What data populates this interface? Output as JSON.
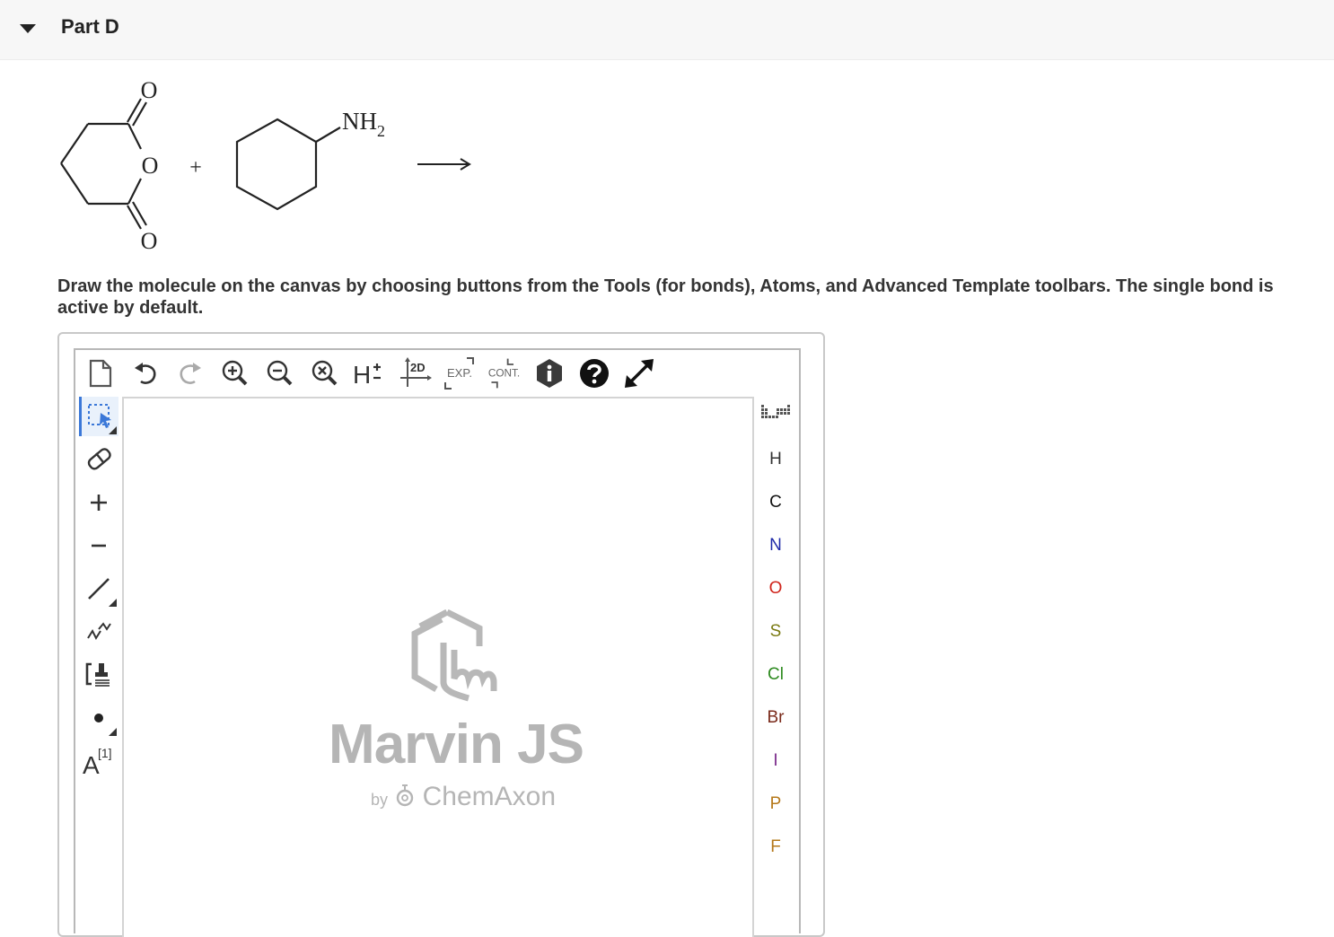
{
  "part": {
    "title": "Part D"
  },
  "reaction": {
    "reactant1_atoms": [
      "O",
      "O",
      "O"
    ],
    "plus": "+",
    "reactant2_group_main": "NH",
    "reactant2_group_sub": "2"
  },
  "instructions": "Draw the molecule on the canvas by choosing buttons from the Tools (for bonds), Atoms, and Advanced Template toolbars. The single bond is active by default.",
  "toolbar": {
    "h_label": "H",
    "clean2d_label": "2D",
    "expand_label": "EXP.",
    "contract_label": "CONT."
  },
  "left_tools": {
    "map_label": "A",
    "map_sup": "[1]"
  },
  "watermark": {
    "title": "Marvin JS",
    "by": "by",
    "brand": "ChemAxon"
  },
  "atoms": [
    {
      "symbol": "H",
      "color": "#333333"
    },
    {
      "symbol": "C",
      "color": "#111111"
    },
    {
      "symbol": "N",
      "color": "#1f2aa8"
    },
    {
      "symbol": "O",
      "color": "#d0241b"
    },
    {
      "symbol": "S",
      "color": "#7a7a12"
    },
    {
      "symbol": "Cl",
      "color": "#2d8a1f"
    },
    {
      "symbol": "Br",
      "color": "#7a2a1a"
    },
    {
      "symbol": "I",
      "color": "#7a2a8a"
    },
    {
      "symbol": "P",
      "color": "#b5781a"
    },
    {
      "symbol": "F",
      "color": "#b5781a"
    }
  ],
  "colors": {
    "accent": "#3b78d8"
  }
}
